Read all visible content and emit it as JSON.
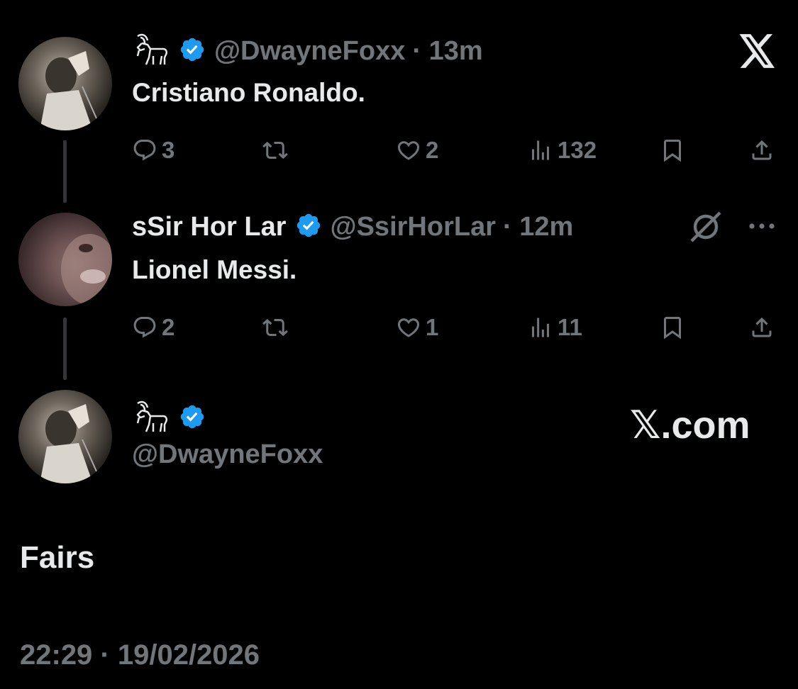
{
  "tweet1": {
    "handle": "@DwayneFoxx",
    "time": "· 13m",
    "text": "Cristiano Ronaldo.",
    "replies": "3",
    "likes": "2",
    "views": "132"
  },
  "tweet2": {
    "name": "sSir Hor Lar",
    "handle": "@SsirHorLar",
    "time": "· 12m",
    "text": "Lionel Messi.",
    "replies": "2",
    "likes": "1",
    "views": "11"
  },
  "main": {
    "handle": "@DwayneFoxx",
    "brand": "𝕏.com",
    "text": "Fairs",
    "timestamp": "22:29 · 19/02/2026"
  },
  "icons": {
    "name_emoji": "goat-icon",
    "verified": "verified-badge-icon",
    "reply": "reply-icon",
    "retweet": "retweet-icon",
    "like": "like-icon",
    "views": "views-icon",
    "bookmark": "bookmark-icon",
    "share": "share-icon",
    "close": "x-logo-icon",
    "more": "more-icon",
    "grok": "grok-icon"
  },
  "colors": {
    "background": "#000000",
    "text": "#e7e9ea",
    "muted": "#71767b",
    "verified": "#1d9bf0"
  }
}
